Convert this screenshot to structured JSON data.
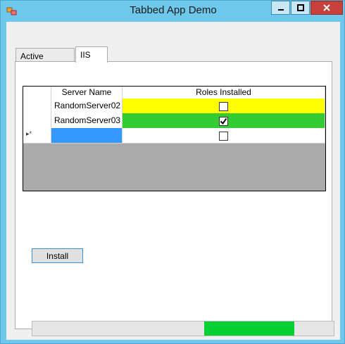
{
  "window": {
    "title": "Tabbed App Demo"
  },
  "tabs": [
    {
      "label": "Active Directory",
      "selected": false
    },
    {
      "label": "IIS",
      "selected": true
    }
  ],
  "grid": {
    "columns": [
      "Server Name",
      "Roles Installed"
    ],
    "rows": [
      {
        "server_name": "RandomServer02",
        "roles_installed": false,
        "row_color": "#ffff00"
      },
      {
        "server_name": "RandomServer03",
        "roles_installed": true,
        "row_color": "#33cc33"
      },
      {
        "server_name": "",
        "roles_installed": false,
        "row_color": "#ffffff",
        "new_row": true,
        "row_header_glyph": "▸*"
      }
    ]
  },
  "install_button": {
    "label": "Install"
  },
  "progress": {
    "marquee_start_fraction": 0.57,
    "marquee_length_fraction": 0.3,
    "fill_color": "#06d132"
  },
  "colors": {
    "selection": "#3399ff"
  }
}
